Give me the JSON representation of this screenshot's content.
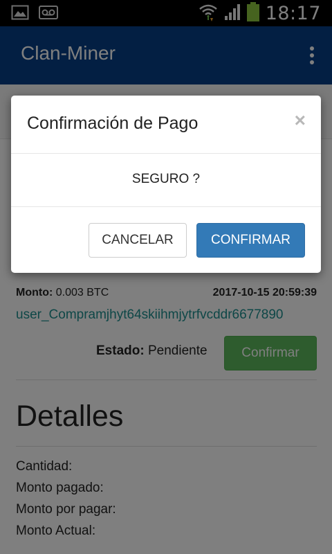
{
  "status_bar": {
    "time": "18:17",
    "icons": [
      "image-icon",
      "voicemail-icon",
      "wifi-icon",
      "signal-icon",
      "battery-icon"
    ]
  },
  "app_bar": {
    "title": "Clan-Miner",
    "menu_icon": "overflow-menu-icon",
    "color": "#073f86"
  },
  "order": {
    "monto_label": "Monto:",
    "monto_value": "0.003 BTC",
    "date": "2017-10-15 20:59:39",
    "user": "user_Compramjhyt64skiihmjytrfvcddr6677890",
    "estado_label": "Estado:",
    "estado_value": "Pendiente",
    "confirm_button": "Confirmar"
  },
  "details": {
    "title": "Detalles",
    "items": [
      "Cantidad:",
      "Monto pagado:",
      "Monto por pagar:",
      "Monto Actual:"
    ]
  },
  "modal": {
    "title": "Confirmación de Pago",
    "close_symbol": "×",
    "body": "SEGURO ?",
    "cancel_label": "CANCELAR",
    "confirm_label": "CONFIRMAR"
  },
  "colors": {
    "primary_button": "#337ab7",
    "success_button": "#5cb85c",
    "link": "#1d8e8e"
  }
}
